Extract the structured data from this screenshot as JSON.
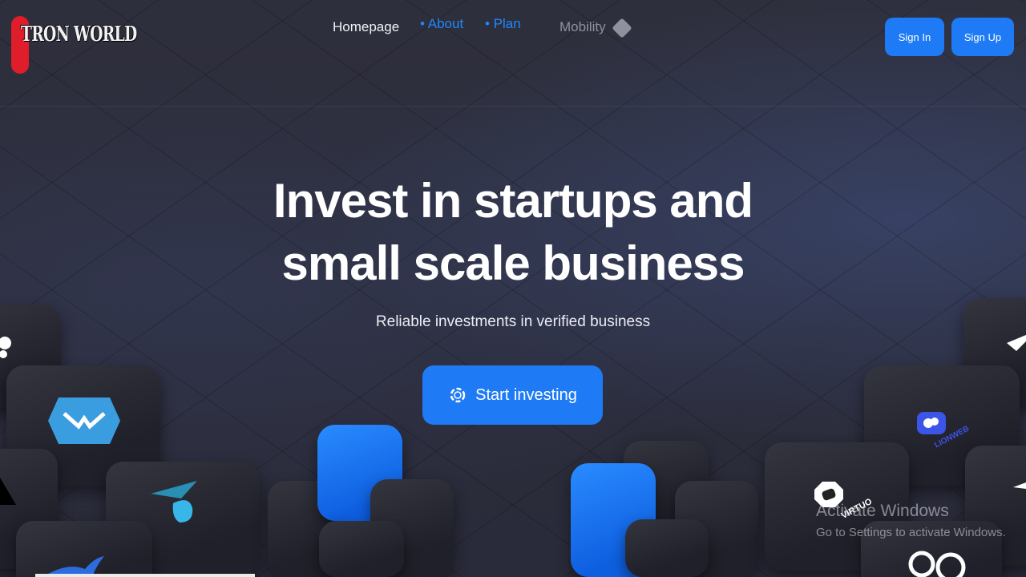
{
  "header": {
    "logo_text": "TRON WORLD",
    "nav": {
      "home": "Homepage",
      "about": "• About",
      "plan": "• Plan",
      "mobility": "Mobility"
    },
    "sign_in": "Sign In",
    "sign_up": "Sign Up"
  },
  "hero": {
    "title_line1": "Invest in startups and",
    "title_line2": "small scale business",
    "subtitle": "Reliable investments in verified business",
    "cta": "Start investing"
  },
  "tiles": {
    "lionweb": "LIONWEB",
    "virtuo": "VIRTUO"
  },
  "watermark": {
    "title": "Activate Windows",
    "subtitle": "Go to Settings to activate Windows."
  },
  "colors": {
    "accent": "#1e7bf5",
    "nav_link": "#1e88ff",
    "background": "#2b2c3a"
  }
}
